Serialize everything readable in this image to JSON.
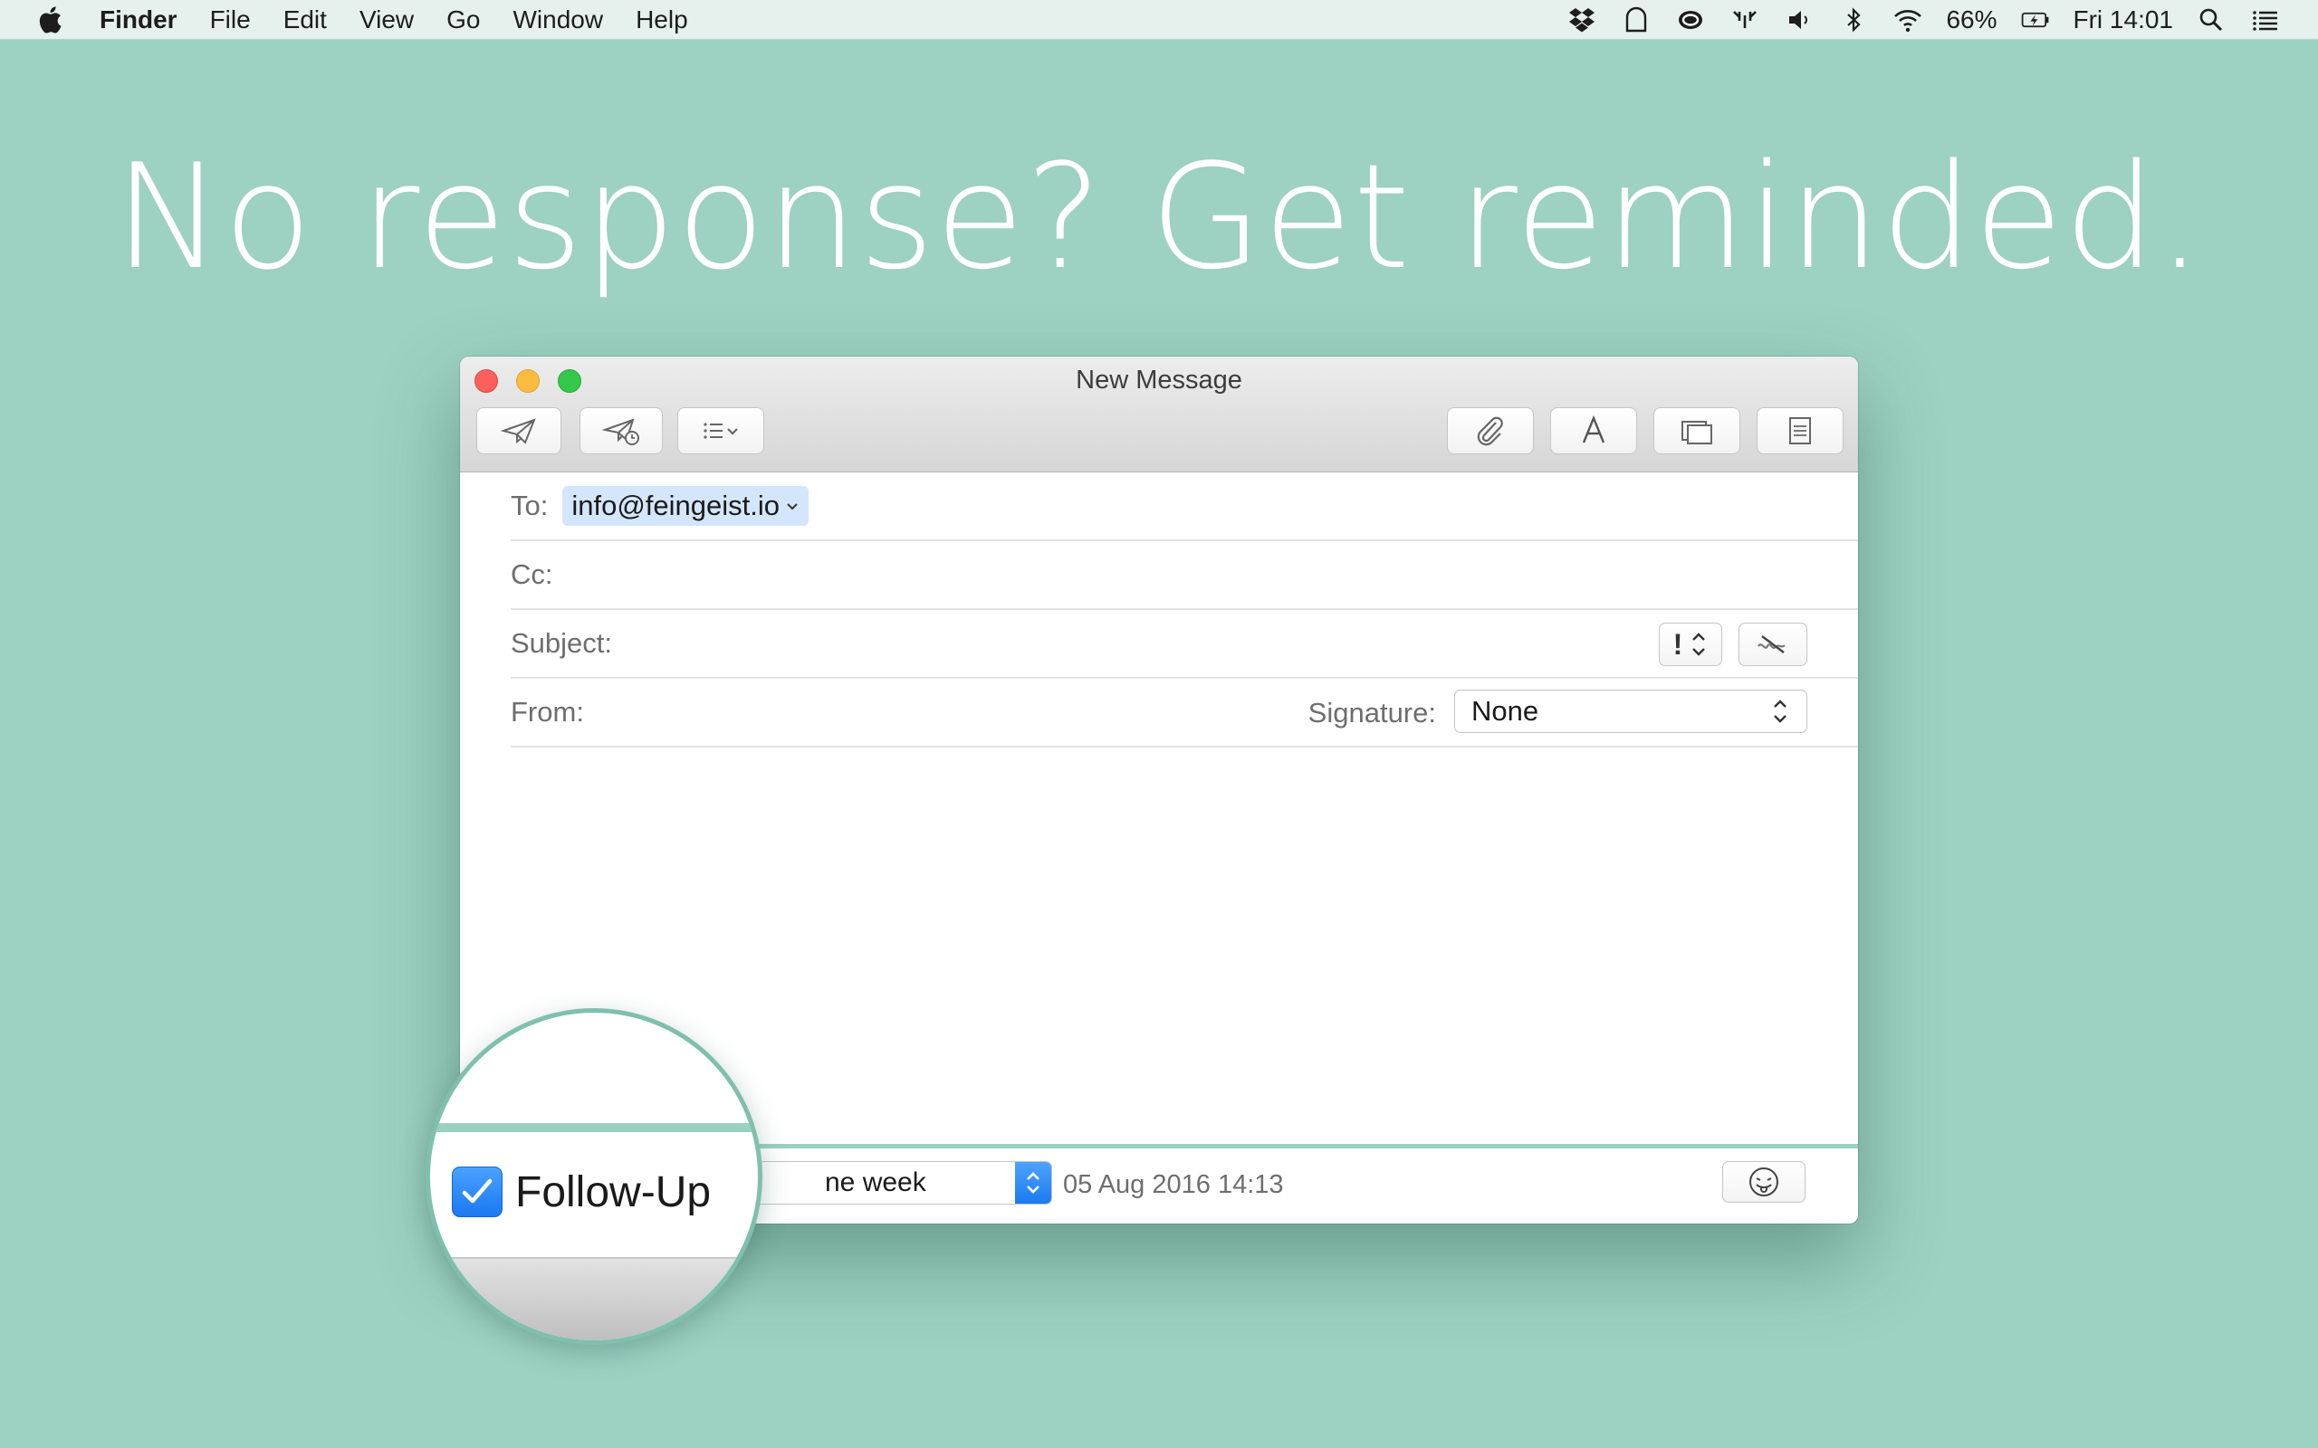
{
  "menubar": {
    "app_name": "Finder",
    "menus": [
      "File",
      "Edit",
      "View",
      "Go",
      "Window",
      "Help"
    ],
    "battery_percent": "66%",
    "clock": "Fri 14:01",
    "icons": [
      "apple-logo-icon",
      "dropbox-icon",
      "notification-bell-icon",
      "creative-cloud-icon",
      "network-activity-icon",
      "volume-icon",
      "bluetooth-icon",
      "wifi-icon",
      "battery-charging-icon",
      "spotlight-search-icon",
      "notification-center-icon"
    ]
  },
  "headline": "No response? Get reminded.",
  "window": {
    "title": "New Message",
    "toolbar_icons": [
      "send-icon",
      "send-later-icon",
      "list-format-icon",
      "attachment-icon",
      "fonts-icon",
      "photo-browser-icon",
      "stationery-icon"
    ],
    "fields": {
      "to_label": "To:",
      "to_value": "info@feingeist.io",
      "cc_label": "Cc:",
      "subject_label": "Subject:",
      "priority_symbol": "!",
      "from_label": "From:",
      "signature_label": "Signature:",
      "signature_value": "None"
    },
    "followup": {
      "checkbox_label": "Follow-Up",
      "checked": true,
      "interval_value": "ne week",
      "date": "05 Aug 2016 14:13"
    }
  },
  "colors": {
    "background": "#9dd1c1",
    "accent_blue": "#1c7af2",
    "strip_green": "#9ad0bf"
  }
}
